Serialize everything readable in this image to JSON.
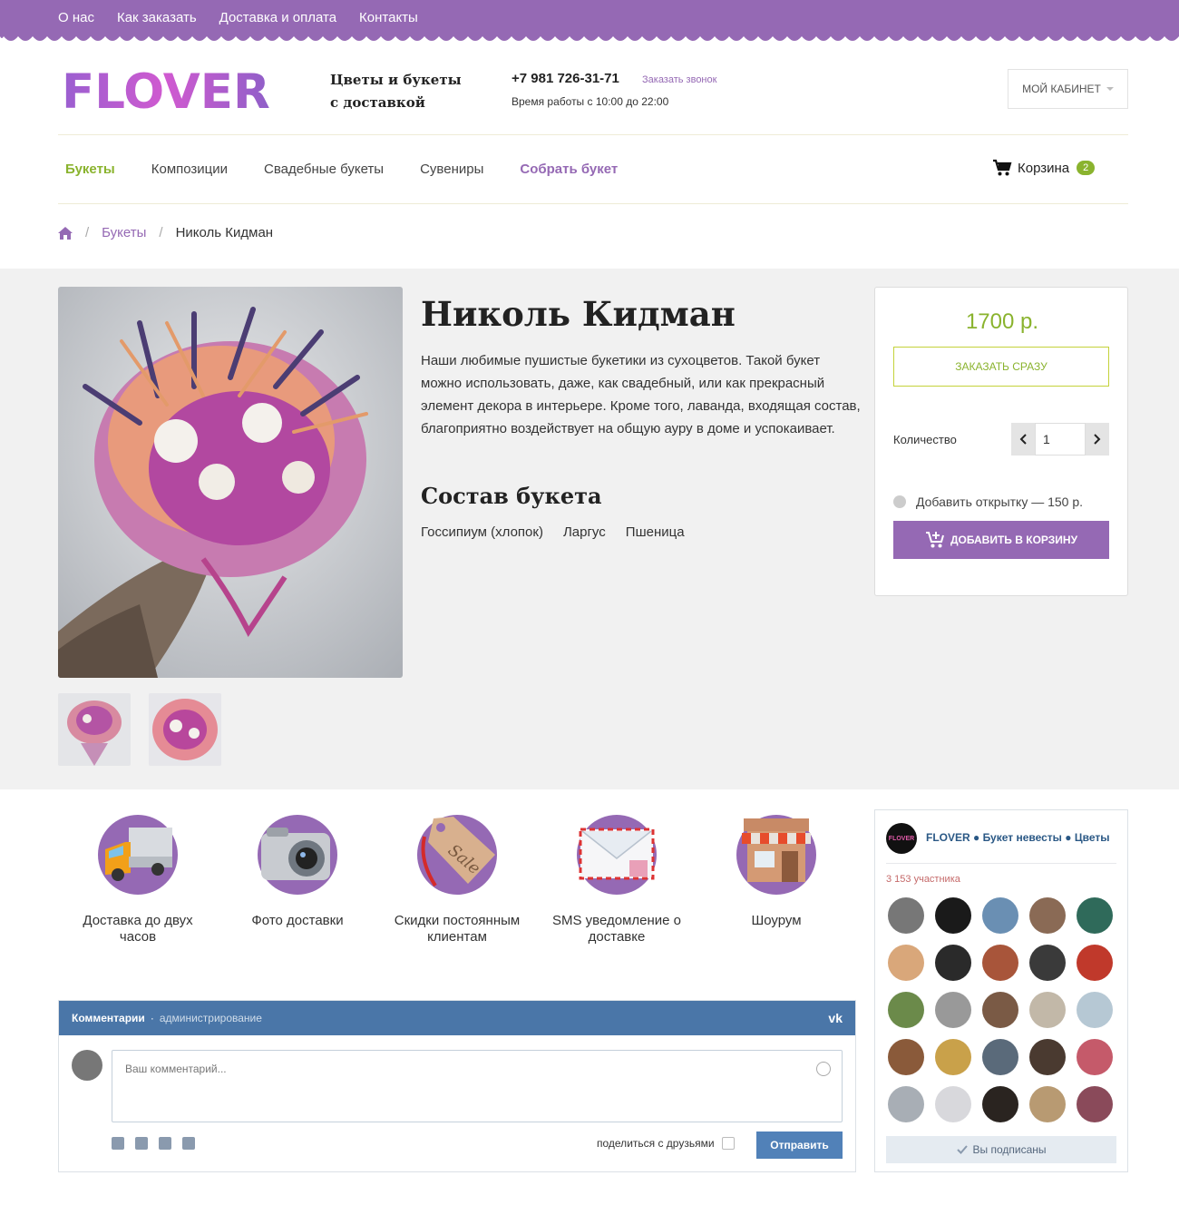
{
  "topnav": [
    "О нас",
    "Как заказать",
    "Доставка и оплата",
    "Контакты"
  ],
  "header": {
    "logo_text": "FLOVER",
    "tagline_line1": "Цветы и букеты",
    "tagline_line2": "с доставкой",
    "phone": "+7 981 726-31-71",
    "callback_label": "Заказать звонок",
    "hours": "Время работы с 10:00 до 22:00",
    "cabinet_label": "МОЙ КАБИНЕТ"
  },
  "menu": {
    "items": [
      "Букеты",
      "Композиции",
      "Свадебные букеты",
      "Сувениры",
      "Собрать букет"
    ],
    "active": "Букеты",
    "cart_label": "Корзина",
    "cart_count": "2"
  },
  "breadcrumb": {
    "section": "Букеты",
    "current": "Николь Кидман"
  },
  "product": {
    "title": "Николь Кидман",
    "description": "Наши любимые пушистые букетики из сухоцветов. Такой букет можно использовать, даже, как свадебный, или как прекрасный элемент декора в интерьере. Кроме того, лаванда, входящая состав, благоприятно воздействует на общую ауру в доме и успокаивает.",
    "composition_title": "Состав букета",
    "composition": [
      "Госсипиум (хлопок)",
      "Ларгус",
      "Пшеница"
    ],
    "price": "1700 р.",
    "order_now_label": "ЗАКАЗАТЬ СРАЗУ",
    "quantity_label": "Количество",
    "quantity_value": "1",
    "card_option_label": "Добавить открытку — 150 р.",
    "add_to_cart_label": "ДОБАВИТЬ В КОРЗИНУ"
  },
  "features": [
    {
      "icon": "truck-icon",
      "label": "Доставка до двух часов"
    },
    {
      "icon": "camera-icon",
      "label": "Фото доставки"
    },
    {
      "icon": "sale-tag-icon",
      "label": "Скидки постоянным клиентам"
    },
    {
      "icon": "envelope-icon",
      "label": "SMS уведомление о доставке"
    },
    {
      "icon": "shop-icon",
      "label": "Шоурум"
    }
  ],
  "vk_comments": {
    "title": "Комментарии",
    "admin_label": "администрирование",
    "placeholder": "Ваш комментарий...",
    "share_label": "поделиться с друзьями",
    "send_label": "Отправить"
  },
  "vk_group": {
    "avatar_text": "FLOVER",
    "name": "FLOVER ● Букет невесты ● Цветы",
    "members": "3 153 участника",
    "subscribed_label": "Вы подписаны"
  },
  "colors": {
    "brand_purple": "#9569b4",
    "brand_green": "#8ab32e",
    "vk_blue": "#4a76a8"
  }
}
